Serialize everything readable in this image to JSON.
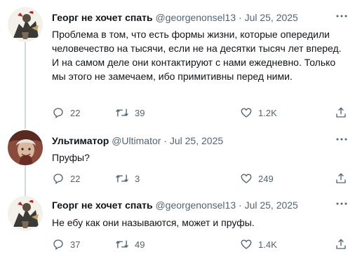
{
  "tweets": [
    {
      "name": "Георг не хочет спать",
      "handle": "@georgenonsel13",
      "separator": "·",
      "date": "Jul 25, 2025",
      "text": "Проблема в том, что есть формы жизни, которые опередили человечество на тысячи, если не на десятки тысяч лет вперед. И на самом деле они контактируют с нами ежедневно. Только мы этого не замечаем, ибо примитивны перед ними.",
      "replies": "22",
      "retweets": "39",
      "likes": "1.2K"
    },
    {
      "name": "Ультиматор",
      "handle": "@Ultimator",
      "separator": "·",
      "date": "Jul 25, 2025",
      "text": "Пруфы?",
      "replies": "22",
      "retweets": "3",
      "likes": "249"
    },
    {
      "name": "Георг не хочет спать",
      "handle": "@georgenonsel13",
      "separator": "·",
      "date": "Jul 25, 2025",
      "text": "Не ебу как они называются, может и пруфы.",
      "replies": "37",
      "retweets": "49",
      "likes": "1.4K"
    }
  ],
  "icons": {
    "more": "more-horizontal-icon",
    "reply": "reply-icon",
    "retweet": "retweet-icon",
    "like": "heart-icon",
    "share": "share-icon"
  },
  "colors": {
    "text": "#0f1419",
    "secondary": "#536471",
    "thread_line": "#cfd9de"
  }
}
